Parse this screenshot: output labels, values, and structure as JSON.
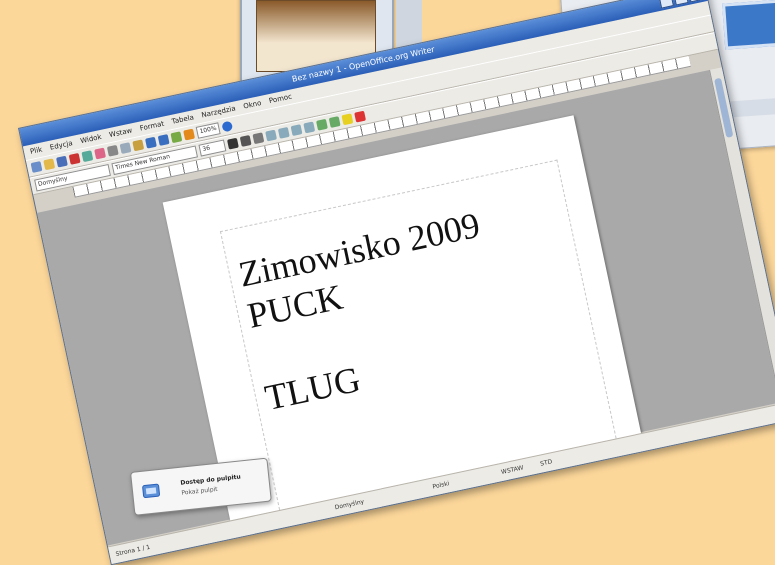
{
  "app": {
    "title": "Bez nazwy 1 - OpenOffice.org Writer",
    "menu": [
      "Plik",
      "Edycja",
      "Widok",
      "Wstaw",
      "Format",
      "Tabela",
      "Narzędzia",
      "Okno",
      "Pomoc"
    ],
    "style_combo": "Domyślny",
    "font_combo": "Times New Roman",
    "size_combo": "36",
    "zoom": "100%"
  },
  "document": {
    "lines": [
      "Zimowisko 2009",
      "PUCK",
      "",
      "TLUG"
    ]
  },
  "status": {
    "page": "Strona 1 / 1",
    "style": "Domyślny",
    "language": "Polski",
    "mode": "WSTAW",
    "selection": "STD"
  },
  "notification": {
    "title": "Dostęp do pulpitu",
    "text": "Pokaż pulpit"
  },
  "colors": {
    "desktop": "#fcd79a",
    "titlebar": "#2b5fb8"
  }
}
